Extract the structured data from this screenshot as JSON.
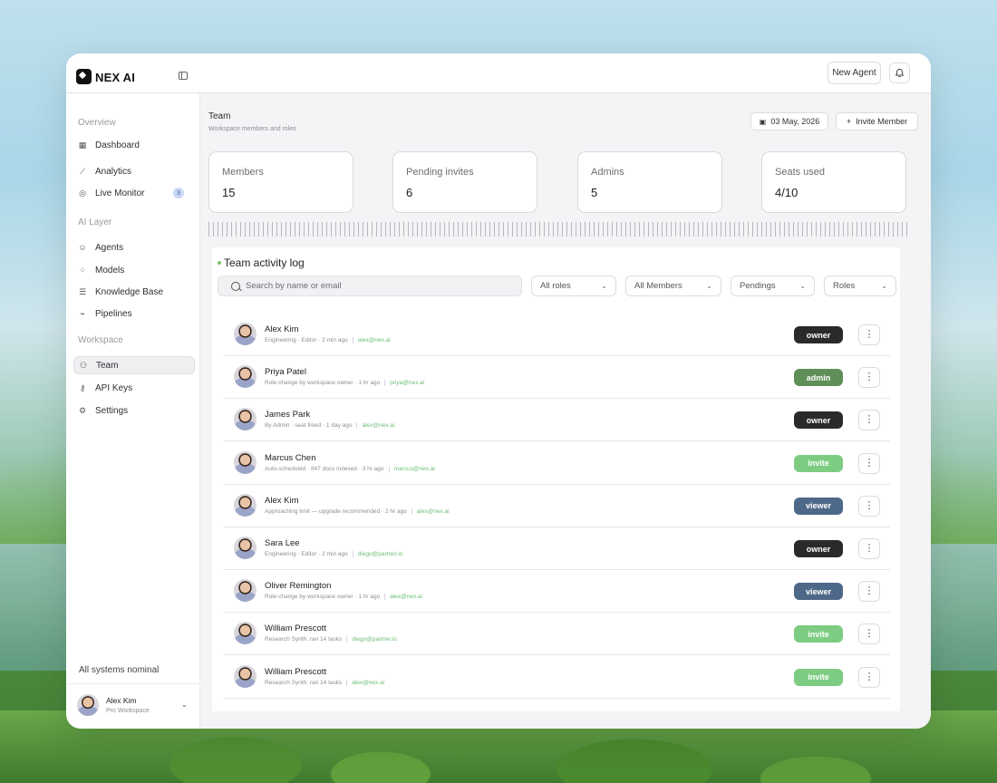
{
  "brand": {
    "name": "NEX AI"
  },
  "topbar": {
    "new_agent_label": "New Agent"
  },
  "sidebar": {
    "sections": [
      "Overview",
      "AI Layer",
      "Workspace"
    ],
    "items": [
      {
        "label": "Dashboard",
        "icon": "grid-icon"
      },
      {
        "label": "Analytics",
        "icon": "chart-icon"
      },
      {
        "label": "Live Monitor",
        "icon": "monitor-icon",
        "badge": "3"
      },
      {
        "label": "Agents",
        "icon": "agent-icon"
      },
      {
        "label": "Models",
        "icon": "model-icon"
      },
      {
        "label": "Knowledge Base",
        "icon": "database-icon"
      },
      {
        "label": "Pipelines",
        "icon": "pipeline-icon"
      },
      {
        "label": "Team",
        "icon": "team-icon",
        "active": true
      },
      {
        "label": "API Keys",
        "icon": "key-icon"
      },
      {
        "label": "Settings",
        "icon": "gear-icon"
      }
    ],
    "status": "All systems nominal",
    "user": {
      "name": "Alex Kim",
      "workspace": "Pro Workspace"
    }
  },
  "page": {
    "title": "Team",
    "subtitle": "Workspace members and roles",
    "date": "03 May, 2026",
    "invite_label": "Invite Member"
  },
  "stats": [
    {
      "label": "Members",
      "value": "15"
    },
    {
      "label": "Pending invites",
      "value": "6"
    },
    {
      "label": "Admins",
      "value": "5"
    },
    {
      "label": "Seats used",
      "value": "4/10"
    }
  ],
  "activity": {
    "title": "Team activity log",
    "search_placeholder": "Search by name or email",
    "filters": [
      "All roles",
      "All Members",
      "Pendings",
      "Roles"
    ],
    "rows": [
      {
        "name": "Alex Kim",
        "meta": "Engineering · Editor · 2 min ago",
        "email": "alex@nex.ai",
        "role": "owner"
      },
      {
        "name": "Priya Patel",
        "meta": "Role change by workspace owner · 1 hr ago",
        "email": "priya@nex.ai",
        "role": "admin"
      },
      {
        "name": "James Park",
        "meta": "By Admin · seat freed · 1 day ago",
        "email": "alex@nex.ai",
        "role": "owner"
      },
      {
        "name": "Marcus Chen",
        "meta": "Auto-scheduled · 847 docs indexed · 3 hr ago",
        "email": "marcus@nex.ai",
        "role": "invite"
      },
      {
        "name": "Alex Kim",
        "meta": "Approaching limit — upgrade recommended · 2 hr ago",
        "email": "alex@nex.ai",
        "role": "viewer"
      },
      {
        "name": "Sara Lee",
        "meta": "Engineering · Editor · 2 min ago",
        "email": "diego@partner.io",
        "role": "owner"
      },
      {
        "name": "Oliver Remington",
        "meta": "Role change by workspace owner · 1 hr ago",
        "email": "alex@nex.ai",
        "role": "viewer"
      },
      {
        "name": "William Prescott",
        "meta": "Research Synth. ran 14 tasks",
        "email": "diego@partner.io",
        "role": "invite"
      },
      {
        "name": "William Prescott",
        "meta": "Research Synth. ran 14 tasks",
        "email": "alex@nex.ai",
        "role": "invite"
      }
    ]
  },
  "colors": {
    "owner": "#2a2a2c",
    "admin": "#5e8f57",
    "invite": "#7dcc82",
    "viewer": "#4d6888",
    "accent_green": "#7ac96b"
  }
}
